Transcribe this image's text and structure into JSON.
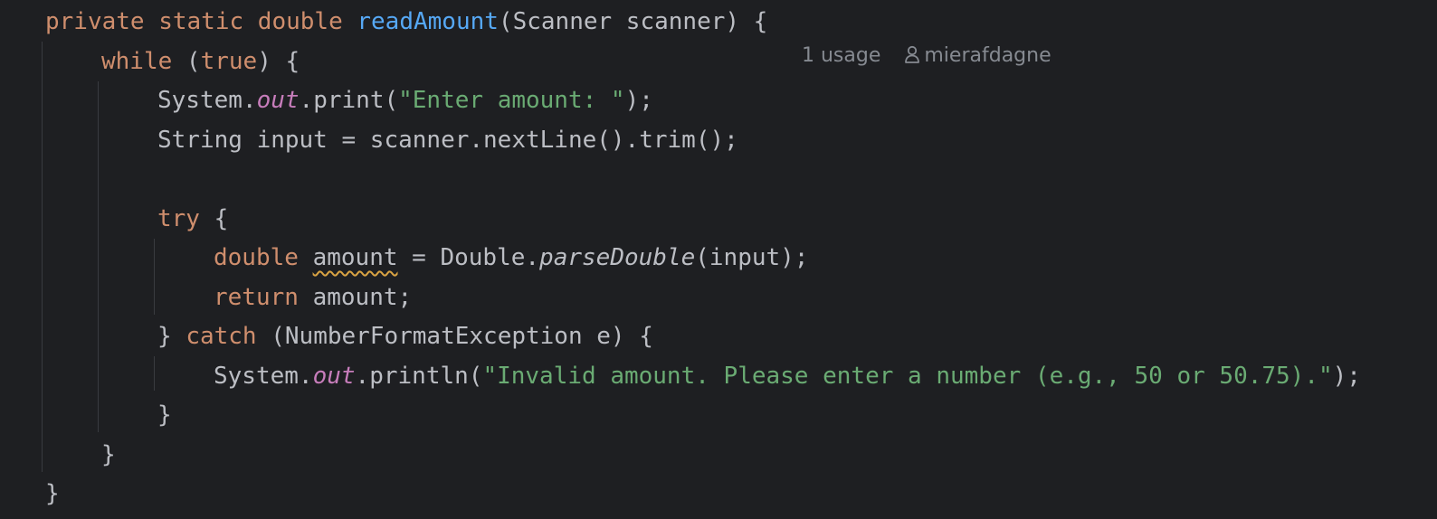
{
  "editor": {
    "code_lines": [
      {
        "tokens": [
          {
            "t": "private static double ",
            "c": "kw"
          },
          {
            "t": "readAmount",
            "c": "fn"
          },
          {
            "t": "(Scanner scanner) {",
            "c": ""
          }
        ]
      },
      {
        "tokens": [
          {
            "t": "while ",
            "c": "kw"
          },
          {
            "t": "(",
            "c": ""
          },
          {
            "t": "true",
            "c": "kw"
          },
          {
            "t": ") {",
            "c": ""
          }
        ]
      },
      {
        "tokens": [
          {
            "t": "System.",
            "c": ""
          },
          {
            "t": "out",
            "c": "field"
          },
          {
            "t": ".print(",
            "c": ""
          },
          {
            "t": "\"Enter amount: \"",
            "c": "str"
          },
          {
            "t": ");",
            "c": ""
          }
        ]
      },
      {
        "tokens": [
          {
            "t": "String input = scanner.nextLine().trim();",
            "c": ""
          }
        ]
      },
      {
        "tokens": []
      },
      {
        "tokens": [
          {
            "t": "try ",
            "c": "kw"
          },
          {
            "t": "{",
            "c": ""
          }
        ]
      },
      {
        "tokens": [
          {
            "t": "double ",
            "c": "kw"
          },
          {
            "t": "amount",
            "c": "warn"
          },
          {
            "t": " = Double.",
            "c": ""
          },
          {
            "t": "parseDouble",
            "c": "static-call"
          },
          {
            "t": "(input);",
            "c": ""
          }
        ]
      },
      {
        "tokens": [
          {
            "t": "return ",
            "c": "kw"
          },
          {
            "t": "amount;",
            "c": ""
          }
        ]
      },
      {
        "tokens": [
          {
            "t": "} ",
            "c": ""
          },
          {
            "t": "catch ",
            "c": "kw"
          },
          {
            "t": "(NumberFormatException e) {",
            "c": ""
          }
        ]
      },
      {
        "tokens": [
          {
            "t": "System.",
            "c": ""
          },
          {
            "t": "out",
            "c": "field"
          },
          {
            "t": ".println(",
            "c": ""
          },
          {
            "t": "\"Invalid amount. Please enter a number (e.g., 50 or 50.75).\"",
            "c": "str"
          },
          {
            "t": ");",
            "c": ""
          }
        ]
      },
      {
        "tokens": [
          {
            "t": "}",
            "c": ""
          }
        ]
      },
      {
        "tokens": [
          {
            "t": "}",
            "c": ""
          }
        ]
      },
      {
        "tokens": [
          {
            "t": "}",
            "c": ""
          }
        ]
      }
    ],
    "inlay_hints": {
      "usages": "1 usage",
      "author": "mierafdagne",
      "author_icon": "person-icon"
    },
    "colors": {
      "background": "#1e1f22",
      "keyword": "#cf8e6d",
      "method_declaration": "#56a8f5",
      "string": "#6aab73",
      "static_field": "#c77dbb",
      "default_text": "#bcbec4",
      "inlay_hint": "#868a91",
      "warning_underline": "#d9a343"
    }
  }
}
